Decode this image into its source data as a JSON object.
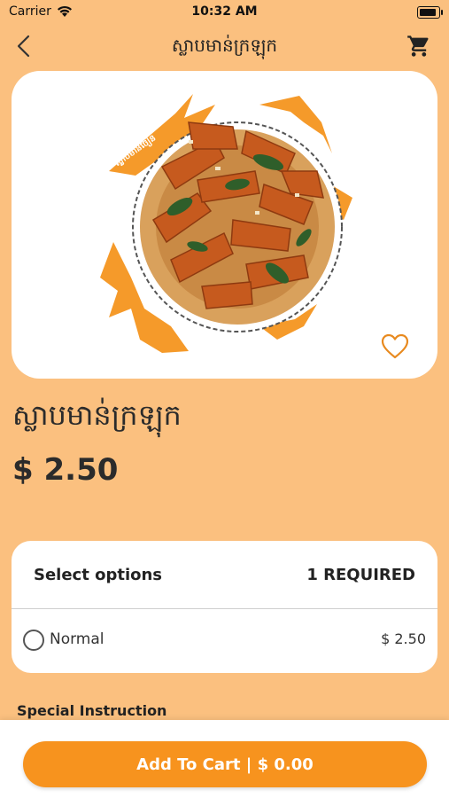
{
  "status_bar": {
    "carrier": "Carrier",
    "time": "10:32 AM",
    "icons": [
      "wifi-icon",
      "battery-icon"
    ]
  },
  "nav": {
    "title": "ស្លាបមាន់ក្រឡុក",
    "icons": [
      "back-icon",
      "cart-icon"
    ]
  },
  "product": {
    "name": "ស្លាបមាន់ក្រឡុក",
    "price": "$ 2.50",
    "favorite_icon": "heart-outline-icon",
    "image_badge": "ស្លាបមាន់ចៀន"
  },
  "options": {
    "title": "Select options",
    "required": "1 REQUIRED",
    "items": [
      {
        "label": "Normal",
        "price": "$ 2.50",
        "selected": false
      }
    ]
  },
  "special_instruction": {
    "label": "Special Instruction"
  },
  "footer": {
    "add_to_cart": "Add To Cart | $ 0.00"
  },
  "colors": {
    "background": "#FBC07F",
    "accent": "#F7931E",
    "card": "#FFFFFF"
  }
}
